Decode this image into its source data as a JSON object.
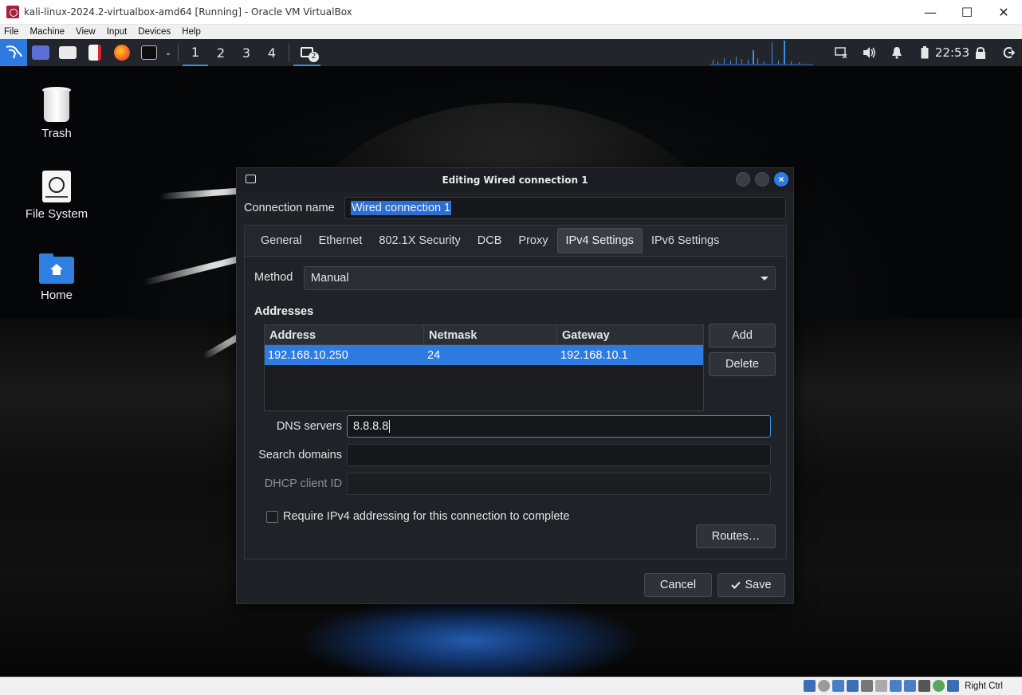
{
  "host": {
    "title": "kali-linux-2024.2-virtualbox-amd64 [Running] - Oracle VM VirtualBox",
    "menu": [
      "File",
      "Machine",
      "View",
      "Input",
      "Devices",
      "Help"
    ],
    "window_buttons": {
      "minimize": "—",
      "maximize": "☐",
      "close": "✕"
    },
    "host_key": "Right Ctrl"
  },
  "panel": {
    "workspaces": [
      "1",
      "2",
      "3",
      "4"
    ],
    "active_workspace": "1",
    "window_count_badge": "2",
    "clock": "22:53"
  },
  "desktop": {
    "icons": [
      {
        "label": "Trash"
      },
      {
        "label": "File System"
      },
      {
        "label": "Home"
      }
    ]
  },
  "dialog": {
    "title": "Editing Wired connection 1",
    "connection_name_label": "Connection name",
    "connection_name_value": "Wired connection 1",
    "tabs": [
      "General",
      "Ethernet",
      "802.1X Security",
      "DCB",
      "Proxy",
      "IPv4 Settings",
      "IPv6 Settings"
    ],
    "active_tab": "IPv4 Settings",
    "method_label": "Method",
    "method_value": "Manual",
    "addresses_heading": "Addresses",
    "columns": [
      "Address",
      "Netmask",
      "Gateway"
    ],
    "rows": [
      {
        "address": "192.168.10.250",
        "netmask": "24",
        "gateway": "192.168.10.1"
      }
    ],
    "add_label": "Add",
    "delete_label": "Delete",
    "dns_label": "DNS servers",
    "dns_value": "8.8.8.8",
    "search_domains_label": "Search domains",
    "search_domains_value": "",
    "dhcp_client_id_label": "DHCP client ID",
    "dhcp_client_id_value": "",
    "require_ipv4_label": "Require IPv4 addressing for this connection to complete",
    "require_ipv4_checked": false,
    "routes_label": "Routes…",
    "cancel_label": "Cancel",
    "save_label": "Save"
  },
  "colors": {
    "accent": "#2d7be0",
    "panel_bg": "#22252b",
    "dialog_bg": "#1e2126"
  }
}
